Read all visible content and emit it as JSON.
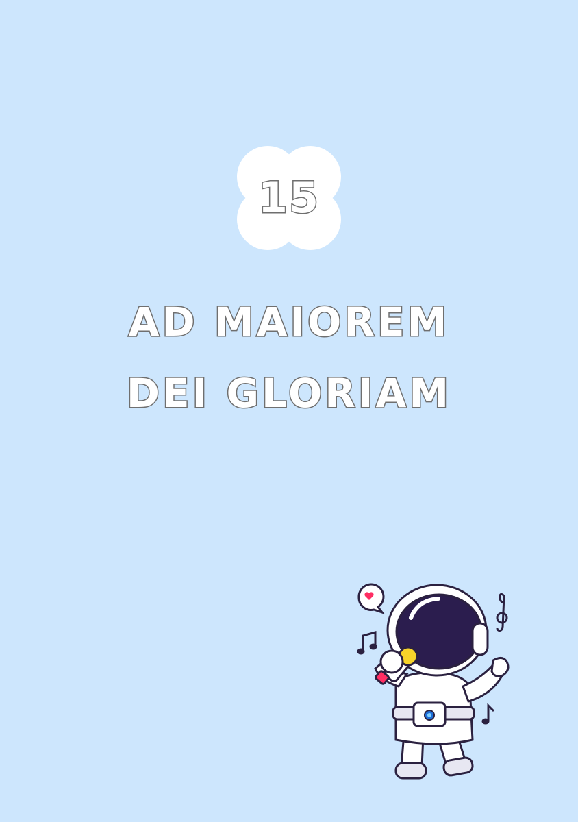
{
  "badge": {
    "number": "15",
    "shape": "cloud",
    "color": "#ffffff"
  },
  "title": {
    "line1": "AD MAIOREM",
    "line2": "DEI GLORIAM"
  },
  "illustration": {
    "name": "singing-astronaut"
  },
  "colors": {
    "background": "#cde6fd",
    "outline": "#6f6f6f"
  }
}
